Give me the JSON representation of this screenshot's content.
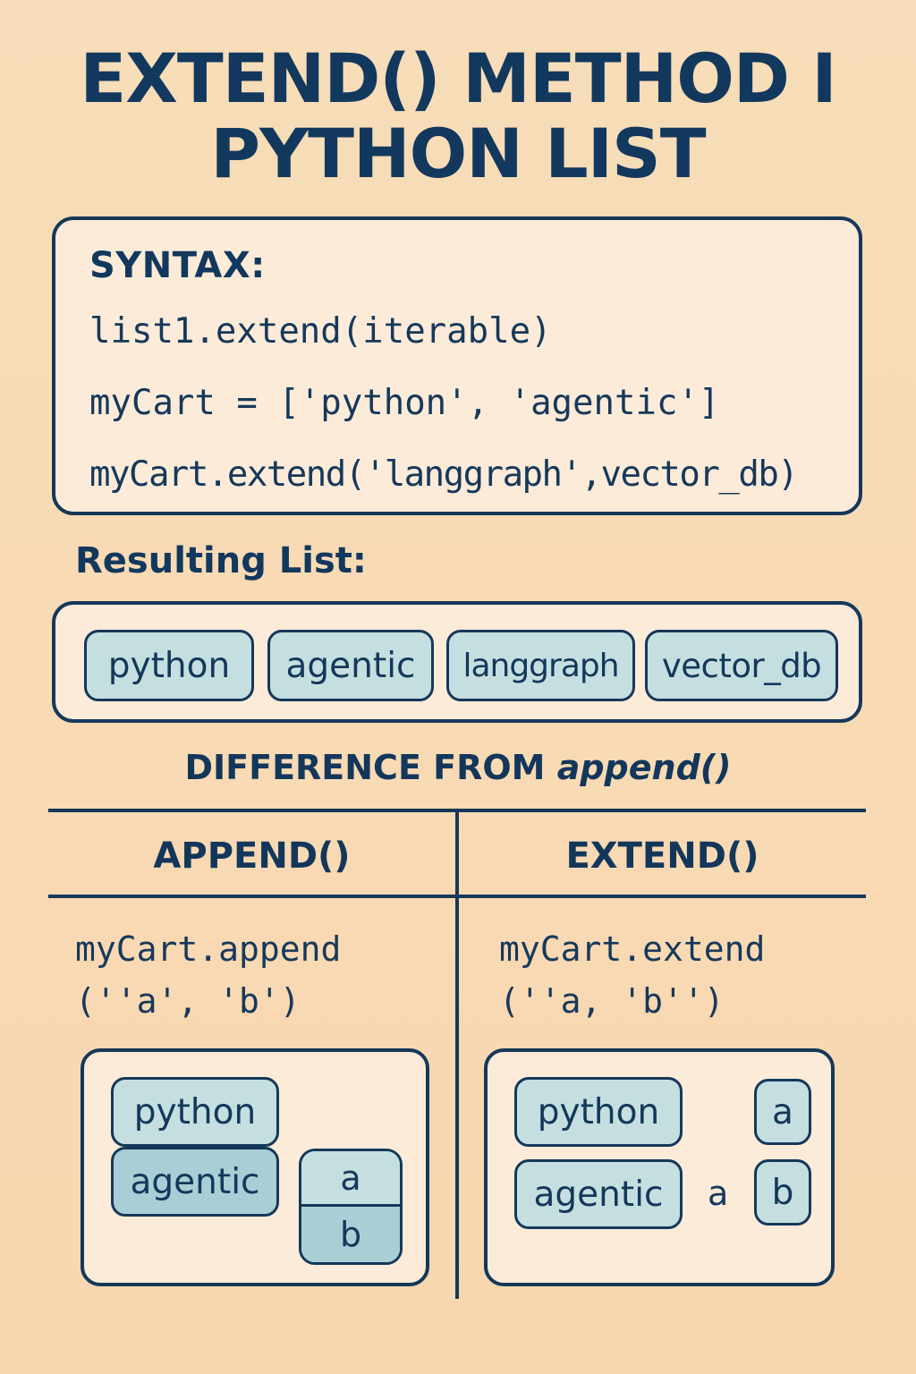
{
  "title": {
    "line1": "EXTEND() METHOD I",
    "line2": "PYTHON LIST"
  },
  "syntax": {
    "label": "SYNTAX:",
    "lines": [
      "list1.extend(iterable)",
      "myCart = ['python', 'agentic']",
      "myCart.extend('langgraph',vector_db)"
    ]
  },
  "result": {
    "label": "Resulting List:",
    "items": [
      "python",
      "agentic",
      "langgraph",
      "vector_db"
    ]
  },
  "difference": {
    "heading_prefix": "DIFFERENCE FROM ",
    "heading_emphasis": "append()"
  },
  "append_col": {
    "header": "APPEND()",
    "code_line1": "myCart.append",
    "code_line2": "(''a', 'b')",
    "items": [
      "python",
      "agentic"
    ],
    "nested": [
      "a",
      "b"
    ]
  },
  "extend_col": {
    "header": "EXTEND()",
    "code_line1": "myCart.extend",
    "code_line2": "(''a, 'b'')",
    "items": [
      "python",
      "agentic"
    ],
    "loose_letter": "a",
    "separate": [
      "a",
      "b"
    ]
  },
  "colors": {
    "background": "#f8d9b3",
    "ink": "#15385a",
    "box_fill": "#fbebd8",
    "chip_fill": "#c5dfe0",
    "chip_fill_dark": "#a9cfd6"
  }
}
